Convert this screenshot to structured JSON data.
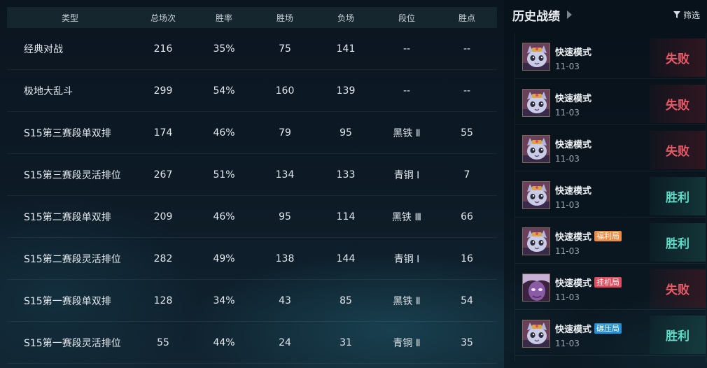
{
  "table": {
    "headers": [
      "类型",
      "总场次",
      "胜率",
      "胜场",
      "负场",
      "段位",
      "胜点"
    ],
    "rows": [
      [
        "经典对战",
        "216",
        "35%",
        "75",
        "141",
        "--",
        "--"
      ],
      [
        "极地大乱斗",
        "299",
        "54%",
        "160",
        "139",
        "--",
        "--"
      ],
      [
        "S15第三赛段单双排",
        "174",
        "46%",
        "79",
        "95",
        "黑铁 Ⅱ",
        "55"
      ],
      [
        "S15第三赛段灵活排位",
        "267",
        "51%",
        "134",
        "133",
        "青铜 Ⅰ",
        "7"
      ],
      [
        "S15第二赛段单双排",
        "209",
        "46%",
        "95",
        "114",
        "黑铁 Ⅲ",
        "66"
      ],
      [
        "S15第二赛段灵活排位",
        "282",
        "49%",
        "138",
        "144",
        "青铜 Ⅰ",
        "16"
      ],
      [
        "S15第一赛段单双排",
        "128",
        "34%",
        "43",
        "85",
        "黑铁 Ⅱ",
        "54"
      ],
      [
        "S15第一赛段灵活排位",
        "55",
        "44%",
        "24",
        "31",
        "青铜 Ⅱ",
        "35"
      ]
    ]
  },
  "history": {
    "title": "历史战绩",
    "filter_label": "筛选",
    "matches": [
      {
        "mode": "快速模式",
        "tag": "",
        "date": "11-03",
        "result": "失败",
        "win": false,
        "avatar": "cat-champion"
      },
      {
        "mode": "快速模式",
        "tag": "",
        "date": "11-03",
        "result": "失败",
        "win": false,
        "avatar": "cat-champion"
      },
      {
        "mode": "快速模式",
        "tag": "",
        "date": "11-03",
        "result": "失败",
        "win": false,
        "avatar": "cat-champion"
      },
      {
        "mode": "快速模式",
        "tag": "",
        "date": "11-03",
        "result": "胜利",
        "win": true,
        "avatar": "cat-champion"
      },
      {
        "mode": "快速模式",
        "tag": "福利局",
        "tag_color": "#f08a3c",
        "date": "11-03",
        "result": "胜利",
        "win": true,
        "avatar": "cat-champion"
      },
      {
        "mode": "快速模式",
        "tag": "挂机局",
        "tag_color": "#e34b5c",
        "date": "11-03",
        "result": "失败",
        "win": false,
        "avatar": "purple-champion"
      },
      {
        "mode": "快速模式",
        "tag": "碾压局",
        "tag_color": "#1e8fd8",
        "date": "11-03",
        "result": "胜利",
        "win": true,
        "avatar": "cat-champion"
      }
    ]
  }
}
